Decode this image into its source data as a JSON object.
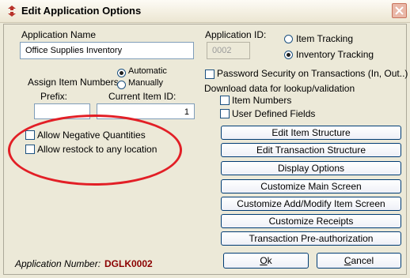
{
  "window": {
    "title": "Edit Application Options"
  },
  "app_name": {
    "label": "Application Name",
    "value": "Office Supplies Inventory"
  },
  "app_id": {
    "label": "Application ID:",
    "value": "0002"
  },
  "mode": {
    "item_tracking": "Item Tracking",
    "inventory_tracking": "Inventory Tracking",
    "selected": "Inventory Tracking"
  },
  "assign": {
    "label": "Assign Item Numbers",
    "automatic": "Automatic",
    "manually": "Manually",
    "selected": "Automatic"
  },
  "prefix": {
    "label": "Prefix:",
    "value": ""
  },
  "current_item_id": {
    "label": "Current Item ID:",
    "value": "1"
  },
  "options": {
    "allow_negative": "Allow Negative Quantities",
    "allow_restock": "Allow restock to any location"
  },
  "security": {
    "password_label": "Password Security on Transactions (In, Out..)"
  },
  "download": {
    "label": "Download data for lookup/validation",
    "item_numbers": "Item Numbers",
    "user_defined_fields": "User Defined Fields"
  },
  "buttons": {
    "edit_item_structure": "Edit Item Structure",
    "edit_transaction_structure": "Edit Transaction Structure",
    "display_options": "Display Options",
    "customize_main_screen": "Customize Main Screen",
    "customize_add_modify": "Customize Add/Modify Item Screen",
    "customize_receipts": "Customize Receipts",
    "transaction_preauth": "Transaction Pre-authorization",
    "ok_first": "O",
    "ok_rest": "k",
    "cancel_first": "C",
    "cancel_rest": "ancel"
  },
  "footer": {
    "label": "Application Number:",
    "value": "DGLK0002"
  },
  "colors": {
    "annotation": "#e21f26",
    "app_number": "#8b0000"
  }
}
